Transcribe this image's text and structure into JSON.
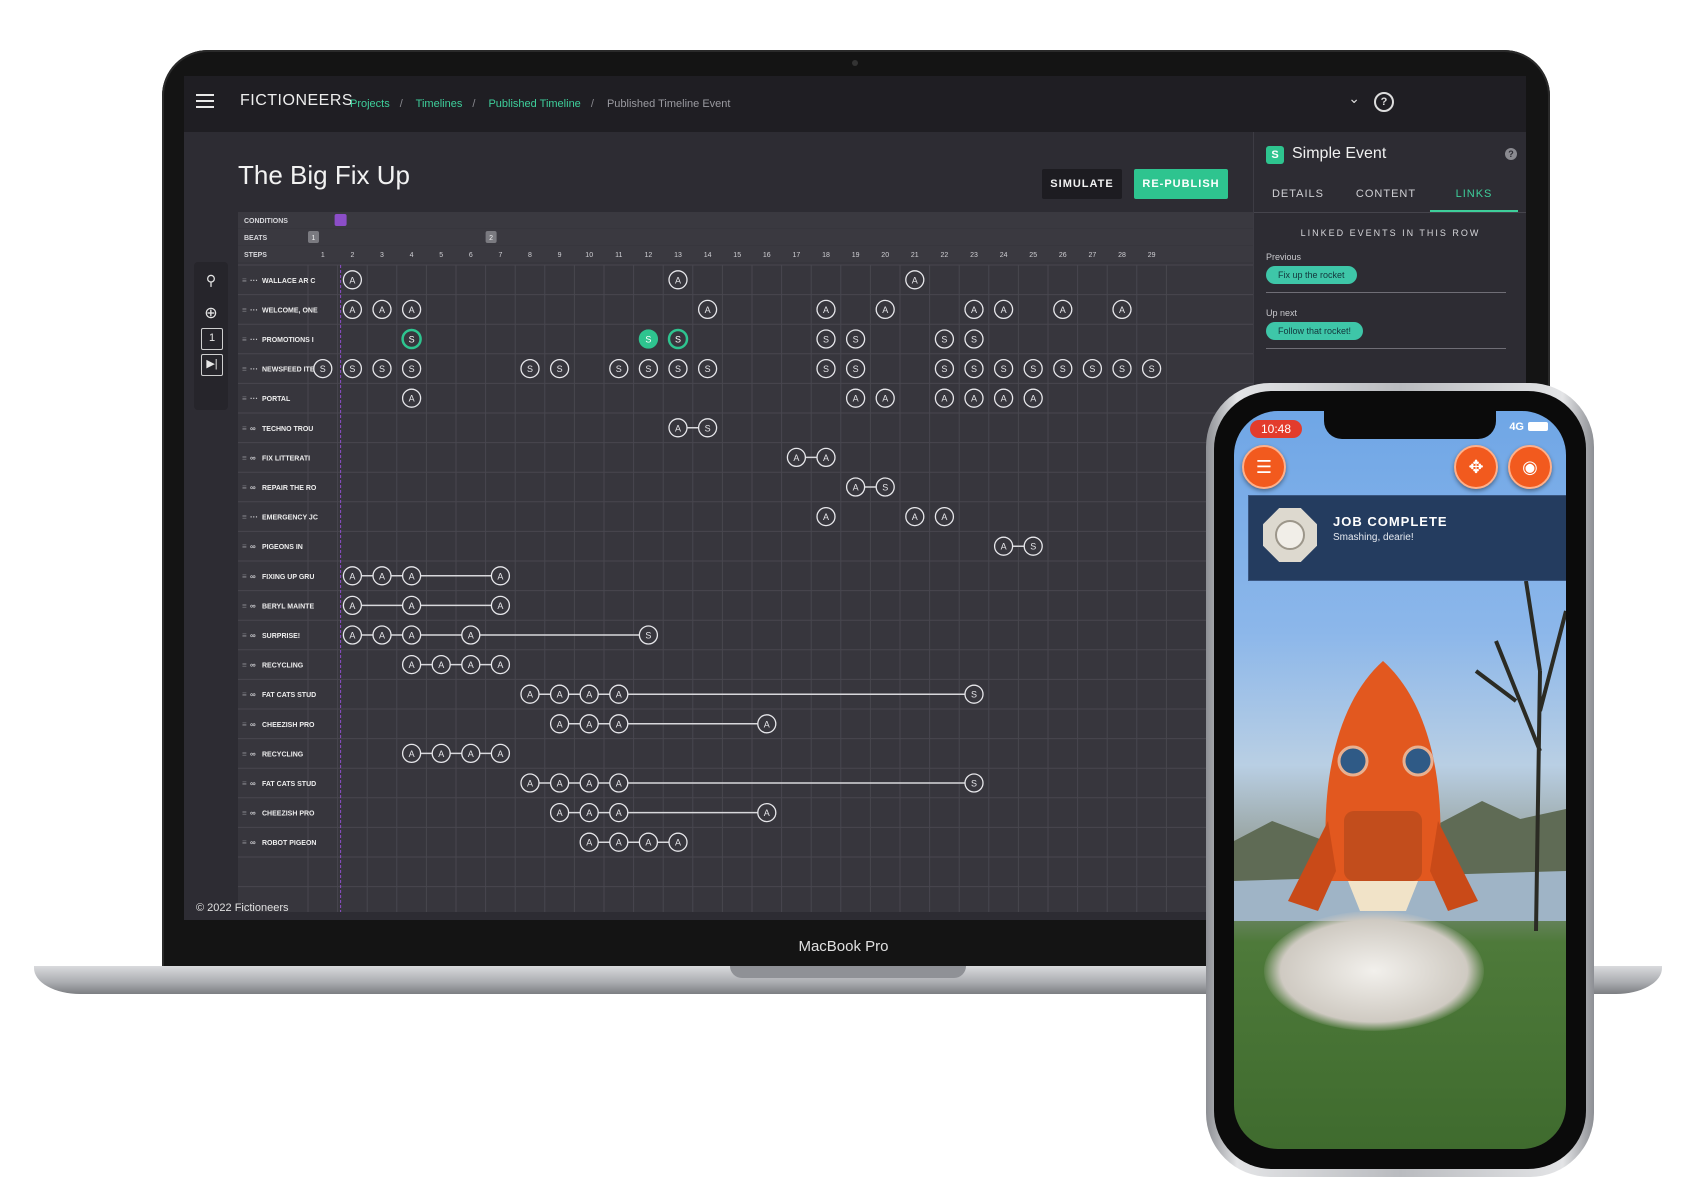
{
  "app": {
    "name": "FICTIONEERS",
    "breadcrumbs": [
      "Projects",
      "Timelines",
      "Published Timeline",
      "Published Timeline Event"
    ],
    "page_title": "The Big Fix Up",
    "buttons": {
      "simulate": "SIMULATE",
      "republish": "RE-PUBLISH"
    },
    "footer": "© 2022 Fictioneers",
    "accent": "#2ec48f",
    "condition_accent": "#8c4ec8"
  },
  "rail": {
    "beat_number": "1"
  },
  "timeline": {
    "row_headers": {
      "conditions": "CONDITIONS",
      "beats": "BEATS",
      "steps": "STEPS"
    },
    "beats": [
      {
        "label": "1",
        "step": 1
      },
      {
        "label": "2",
        "step": 7
      }
    ],
    "steps": [
      "1",
      "2",
      "3",
      "4",
      "5",
      "6",
      "7",
      "8",
      "9",
      "10",
      "11",
      "12",
      "13",
      "14",
      "15",
      "16",
      "17",
      "18",
      "19",
      "20",
      "21",
      "22",
      "23",
      "24",
      "25",
      "26",
      "27",
      "28",
      "29"
    ],
    "rows": [
      {
        "name": "WALLACE AR C",
        "icon": "dots",
        "events": [
          [
            2,
            "A"
          ],
          [
            13,
            "A"
          ],
          [
            21,
            "A"
          ]
        ],
        "chains": []
      },
      {
        "name": "WELCOME, ONE",
        "icon": "dots",
        "events": [
          [
            2,
            "A"
          ],
          [
            3,
            "A"
          ],
          [
            4,
            "A"
          ],
          [
            14,
            "A"
          ],
          [
            18,
            "A"
          ],
          [
            20,
            "A"
          ],
          [
            23,
            "A"
          ],
          [
            24,
            "A"
          ],
          [
            26,
            "A"
          ],
          [
            28,
            "A"
          ]
        ],
        "chains": []
      },
      {
        "name": "PROMOTIONS I",
        "icon": "dots",
        "events": [
          [
            4,
            "S",
            "ring"
          ],
          [
            12,
            "S",
            "fill"
          ],
          [
            13,
            "S",
            "ring"
          ],
          [
            18,
            "S"
          ],
          [
            19,
            "S"
          ],
          [
            22,
            "S"
          ],
          [
            23,
            "S"
          ]
        ],
        "chains": []
      },
      {
        "name": "NEWSFEED ITE",
        "icon": "dots",
        "events": [
          [
            1,
            "S"
          ],
          [
            2,
            "S"
          ],
          [
            3,
            "S"
          ],
          [
            4,
            "S"
          ],
          [
            8,
            "S"
          ],
          [
            9,
            "S"
          ],
          [
            11,
            "S"
          ],
          [
            12,
            "S"
          ],
          [
            13,
            "S"
          ],
          [
            14,
            "S"
          ],
          [
            18,
            "S"
          ],
          [
            19,
            "S"
          ],
          [
            22,
            "S"
          ],
          [
            23,
            "S"
          ],
          [
            24,
            "S"
          ],
          [
            25,
            "S"
          ],
          [
            26,
            "S"
          ],
          [
            27,
            "S"
          ],
          [
            28,
            "S"
          ],
          [
            29,
            "S"
          ]
        ],
        "chains": []
      },
      {
        "name": "PORTAL",
        "icon": "dots",
        "events": [
          [
            4,
            "A"
          ],
          [
            19,
            "A"
          ],
          [
            20,
            "A"
          ],
          [
            22,
            "A"
          ],
          [
            23,
            "A"
          ],
          [
            24,
            "A"
          ],
          [
            25,
            "A"
          ]
        ],
        "chains": []
      },
      {
        "name": "TECHNO TROU",
        "icon": "link",
        "events": [
          [
            13,
            "A"
          ],
          [
            14,
            "S"
          ]
        ],
        "chains": [
          [
            13,
            14
          ]
        ]
      },
      {
        "name": "FIX LITTERATI",
        "icon": "link",
        "events": [
          [
            17,
            "A"
          ],
          [
            18,
            "A"
          ]
        ],
        "chains": [
          [
            17,
            18
          ]
        ]
      },
      {
        "name": "REPAIR THE RO",
        "icon": "link",
        "events": [
          [
            19,
            "A"
          ],
          [
            20,
            "S"
          ]
        ],
        "chains": [
          [
            19,
            20
          ]
        ]
      },
      {
        "name": "EMERGENCY JC",
        "icon": "dots",
        "events": [
          [
            18,
            "A"
          ],
          [
            21,
            "A"
          ],
          [
            22,
            "A"
          ]
        ],
        "chains": []
      },
      {
        "name": "PIGEONS IN",
        "icon": "link",
        "events": [
          [
            24,
            "A"
          ],
          [
            25,
            "S"
          ]
        ],
        "chains": [
          [
            24,
            25
          ]
        ]
      },
      {
        "name": "FIXING UP GRU",
        "icon": "link",
        "events": [
          [
            2,
            "A"
          ],
          [
            3,
            "A"
          ],
          [
            4,
            "A"
          ],
          [
            7,
            "A"
          ]
        ],
        "chains": [
          [
            2,
            7
          ]
        ]
      },
      {
        "name": "BERYL MAINTE",
        "icon": "link",
        "events": [
          [
            2,
            "A"
          ],
          [
            4,
            "A"
          ],
          [
            7,
            "A"
          ]
        ],
        "chains": [
          [
            2,
            7
          ]
        ]
      },
      {
        "name": "SURPRISE!",
        "icon": "link",
        "events": [
          [
            2,
            "A"
          ],
          [
            3,
            "A"
          ],
          [
            4,
            "A"
          ],
          [
            6,
            "A"
          ],
          [
            12,
            "S"
          ]
        ],
        "chains": [
          [
            2,
            12
          ]
        ]
      },
      {
        "name": "RECYCLING",
        "icon": "link",
        "events": [
          [
            4,
            "A"
          ],
          [
            5,
            "A"
          ],
          [
            6,
            "A"
          ],
          [
            7,
            "A"
          ]
        ],
        "chains": [
          [
            4,
            7
          ]
        ]
      },
      {
        "name": "FAT CATS STUD",
        "icon": "link",
        "events": [
          [
            8,
            "A"
          ],
          [
            9,
            "A"
          ],
          [
            10,
            "A"
          ],
          [
            11,
            "A"
          ],
          [
            23,
            "S"
          ]
        ],
        "chains": [
          [
            8,
            23
          ]
        ]
      },
      {
        "name": "CHEEZISH PRO",
        "icon": "link",
        "events": [
          [
            9,
            "A"
          ],
          [
            10,
            "A"
          ],
          [
            11,
            "A"
          ],
          [
            16,
            "A"
          ]
        ],
        "chains": [
          [
            9,
            16
          ]
        ]
      },
      {
        "name": "RECYCLING",
        "icon": "link",
        "events": [
          [
            4,
            "A"
          ],
          [
            5,
            "A"
          ],
          [
            6,
            "A"
          ],
          [
            7,
            "A"
          ]
        ],
        "chains": [
          [
            4,
            7
          ]
        ]
      },
      {
        "name": "FAT CATS STUD",
        "icon": "link",
        "events": [
          [
            8,
            "A"
          ],
          [
            9,
            "A"
          ],
          [
            10,
            "A"
          ],
          [
            11,
            "A"
          ],
          [
            23,
            "S"
          ]
        ],
        "chains": [
          [
            8,
            23
          ]
        ]
      },
      {
        "name": "CHEEZISH PRO",
        "icon": "link",
        "events": [
          [
            9,
            "A"
          ],
          [
            10,
            "A"
          ],
          [
            11,
            "A"
          ],
          [
            16,
            "A"
          ]
        ],
        "chains": [
          [
            9,
            16
          ]
        ]
      },
      {
        "name": "ROBOT PIGEON",
        "icon": "link",
        "events": [
          [
            10,
            "A"
          ],
          [
            11,
            "A"
          ],
          [
            12,
            "A"
          ],
          [
            13,
            "A"
          ]
        ],
        "chains": [
          [
            10,
            13
          ]
        ]
      }
    ]
  },
  "panel": {
    "badge": "S",
    "title": "Simple Event",
    "tabs": [
      "DETAILS",
      "CONTENT",
      "LINKS"
    ],
    "active_tab": "LINKS",
    "section": "LINKED EVENTS IN THIS ROW",
    "previous_label": "Previous",
    "previous_event": "Fix up the rocket",
    "next_label": "Up next",
    "next_event": "Follow that rocket!"
  },
  "laptop_label": "MacBook Pro",
  "phone": {
    "time": "10:48",
    "network": "4G",
    "left_button_icon": "clipboard-icon",
    "right_button_icons": [
      "move-icon",
      "camera-icon"
    ],
    "notification": {
      "title": "JOB COMPLETE",
      "subtitle": "Smashing, dearie!"
    }
  }
}
